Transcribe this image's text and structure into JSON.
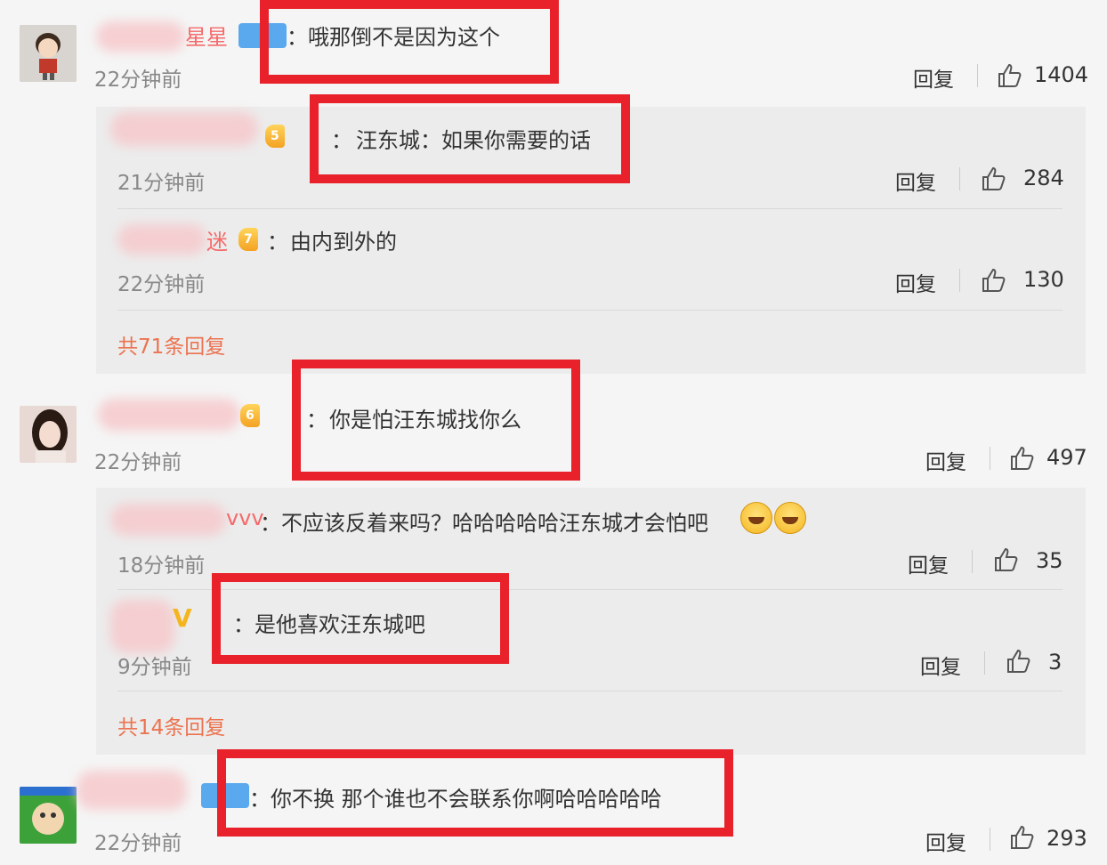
{
  "comments": [
    {
      "name_visible": "星星",
      "text": "哦那倒不是因为这个",
      "time": "22分钟前",
      "reply_label": "回复",
      "likes": "1404",
      "avatar_icon": "cartoon-boy-avatar",
      "replies": [
        {
          "text": "汪东城：如果你需要的话",
          "badge": "5",
          "time": "21分钟前",
          "reply_label": "回复",
          "likes": "284"
        },
        {
          "name_visible": "迷",
          "text": "由内到外的",
          "badge": "7",
          "time": "22分钟前",
          "reply_label": "回复",
          "likes": "130"
        }
      ],
      "total_replies": "共71条回复"
    },
    {
      "text": "你是怕汪东城找你么",
      "badge": "6",
      "time": "22分钟前",
      "reply_label": "回复",
      "likes": "497",
      "avatar_icon": "girl-photo-avatar",
      "replies": [
        {
          "name_visible": "vvv",
          "text": "不应该反着来吗？哈哈哈哈哈汪东城才会怕吧",
          "time": "18分钟前",
          "reply_label": "回复",
          "likes": "35"
        },
        {
          "name_visible": "V",
          "text": "是他喜欢汪东城吧",
          "time": "9分钟前",
          "reply_label": "回复",
          "likes": "3"
        }
      ],
      "total_replies": "共14条回复"
    },
    {
      "text": "你不换 那个谁也不会联系你啊哈哈哈哈哈",
      "time": "22分钟前",
      "reply_label": "回复",
      "likes": "293",
      "avatar_icon": "cartoon-character-avatar"
    }
  ],
  "colors": {
    "username": "#f56a6a",
    "highlight_box": "#e8212a",
    "total_link": "#eb7350",
    "reply_bg": "#ececec"
  }
}
